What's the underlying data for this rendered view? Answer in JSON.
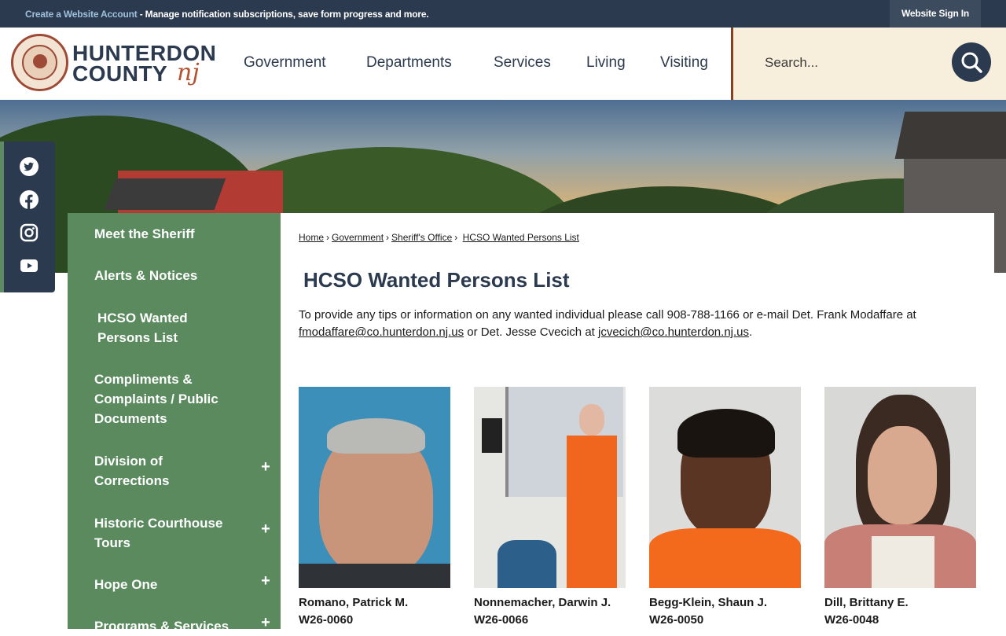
{
  "topbar": {
    "create_account_link": "Create a Website Account",
    "notice_text": " - Manage notification subscriptions, save form progress and more.",
    "signin_label": "Website Sign In"
  },
  "header": {
    "brand_line1": "HUNTERDON",
    "brand_line2": "COUNTY",
    "brand_suffix": "nj",
    "nav": [
      "Government",
      "Departments",
      "Services",
      "Living",
      "Visiting"
    ],
    "search_placeholder": "Search..."
  },
  "social": [
    "twitter-icon",
    "facebook-icon",
    "instagram-icon",
    "youtube-icon"
  ],
  "sidebar": {
    "items": [
      {
        "label": "Meet the Sheriff",
        "expandable": false
      },
      {
        "label": "Alerts & Notices",
        "expandable": false
      },
      {
        "label": "HCSO Wanted Persons List",
        "expandable": false
      },
      {
        "label": "Compliments & Complaints / Public Documents",
        "expandable": false
      },
      {
        "label": "Division of Corrections",
        "expandable": true
      },
      {
        "label": "Historic Courthouse Tours",
        "expandable": true
      },
      {
        "label": "Hope One",
        "expandable": true
      },
      {
        "label": "Programs & Services",
        "expandable": true
      }
    ],
    "expand_symbol": "+"
  },
  "breadcrumb": [
    "Home",
    "Government",
    "Sheriff's Office",
    "HCSO Wanted Persons List"
  ],
  "page_title": "HCSO Wanted Persons List",
  "intro": {
    "text1": "To provide any tips or information on any wanted individual please call 908-788-1166 or e-mail Det. Frank Modaffare at ",
    "email1": "fmodaffare@co.hunterdon.nj.us",
    "text2": " or Det. Jesse Cvecich at ",
    "email2": "jcvecich@co.hunterdon.nj.us",
    "text3": "."
  },
  "persons": [
    {
      "name": "Romano, Patrick M.",
      "id": "W26-0060"
    },
    {
      "name": "Nonnemacher, Darwin J.",
      "id": "W26-0066"
    },
    {
      "name": "Begg-Klein, Shaun J.",
      "id": "W26-0050"
    },
    {
      "name": "Dill, Brittany E.",
      "id": "W26-0048"
    }
  ],
  "colors": {
    "navy": "#2b3a4e",
    "sidebar_green": "#5a8a5e",
    "accent_rust": "#8a3f25",
    "search_bg": "#f8eedc"
  }
}
